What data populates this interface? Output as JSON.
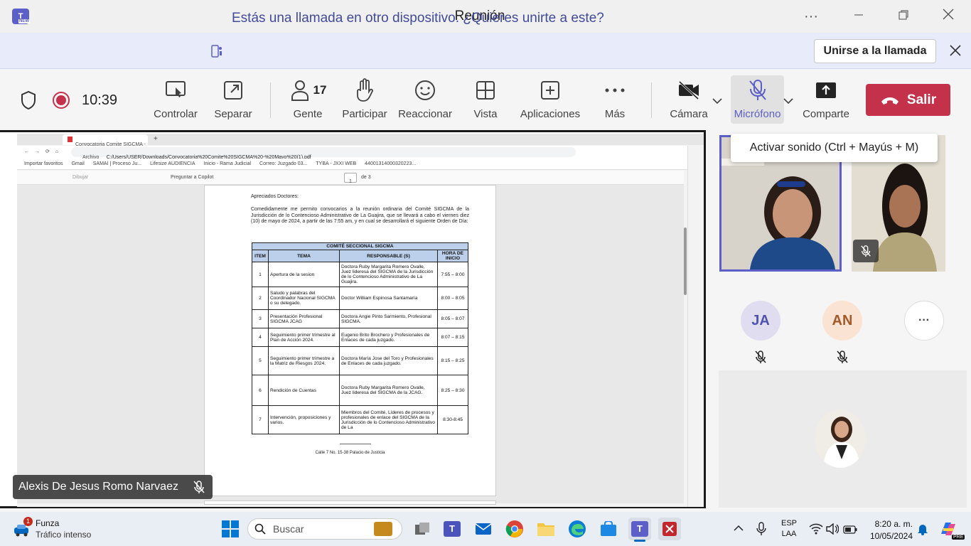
{
  "window": {
    "title": "Reunión",
    "more": "···"
  },
  "banner": {
    "text": "Estás una llamada en otro dispositivo. ¿Quieres unirte a este?",
    "join_label": "Unirse a la llamada"
  },
  "toolbar": {
    "time": "10:39",
    "items": [
      {
        "label": "Controlar"
      },
      {
        "label": "Separar"
      },
      {
        "label": "Gente",
        "count": "17"
      },
      {
        "label": "Participar"
      },
      {
        "label": "Reaccionar"
      },
      {
        "label": "Vista"
      },
      {
        "label": "Aplicaciones"
      },
      {
        "label": "Más"
      },
      {
        "label": "Cámara"
      },
      {
        "label": "Micrófono"
      },
      {
        "label": "Comparte"
      }
    ],
    "leave_label": "Salir"
  },
  "tooltip": "Activar sonido (Ctrl + Mayús + M)",
  "browser": {
    "tab_title": "Convocatoria Comite SIGCMA - I",
    "address_label": "Archivo",
    "address": "C:/Users/USER/Downloads/Convocatoria%20Comite%20SIGCMA%20-%20Mayo%20(1).pdf",
    "bookmarks": [
      "Importar favoritos",
      "Gmail",
      "SAMAI | Proceso Ju...",
      "Lifesize AUDIENCIA",
      "Inicio - Rama Judicial",
      "Correo: Juzgado 03...",
      "TYBA - JXXI WEB",
      "44001314000320223..."
    ],
    "pdf_toolbar": {
      "draw": "Dibujar",
      "ask": "Preguntar a Copilot",
      "page": "1",
      "of": "de 3"
    }
  },
  "document": {
    "greeting": "Apreciados Doctores:",
    "intro": "Comedidamente me permito convocarios a la reunión ordinaria del Comité SIGCMA de la Jurisdicción de lo Contencioso Administrativo de La Guajira, que se llevará a cabo el viernes diez (10) de mayo de 2024, a partir de las 7:55 am, y en cual se desarrollará el siguiente Orden de Día:",
    "table_title": "COMITÉ SECCIONAL SIGCMA",
    "headers": [
      "ITEM",
      "TEMA",
      "RESPONSABLE (S)",
      "HORA DE INICIO"
    ],
    "rows": [
      [
        "1",
        "Apertura de la sesion",
        "Doctora Ruby Margarita Romero Ovalle, Juez lideresa del SIGCMA de la Jurisdicción de lo Contencioso Administrativo de La Guajira.",
        "7:55 – 8:00"
      ],
      [
        "2",
        "Saludo y palabras del Coordinador Nacional SIGCMA o su delegado.",
        "Doctor William Espinosa Santamaría",
        "8:00 – 8:05"
      ],
      [
        "3",
        "Presentación Profesional SIGCMA JCAG",
        "Doctora Angie Pinto Sarmiento, Profesional SIGCMA.",
        "8:05 – 8:07"
      ],
      [
        "4",
        "Seguimiento primer trimestre al Plan de Acción 2024.",
        "Eugenio Brito Brochero y Profesionales de Enlaces de cada juzgado.",
        "8:07 – 8:15"
      ],
      [
        "5",
        "Seguimiento primer trimestre a la Matriz de Riesgos 2024.",
        "Doctora María Jose del Toro y Profesionales de Enlaces de cada juzgado.",
        "8:15 – 8:25"
      ],
      [
        "6",
        "Rendición de Cuentas",
        "Doctora Ruby Margarita Romero Ovalle, Juez lideresa del SIGCMA de la JCAG.",
        "8:25 – 8:30"
      ],
      [
        "7",
        "Intervención, proposiciones y varios.",
        "Miembros del Comité, Líderes de procesos y profesionales de enlace del SIGCMA de la Jurisdicción de lo Contencioso Administrativo de La",
        "8:30-8:45"
      ]
    ],
    "footer": "Calle 7 No. 15-38 Palacio de Justicia"
  },
  "presenter_name": "Alexis De Jesus Romo Narvaez",
  "participants": [
    {
      "initials": "JA"
    },
    {
      "initials": "AN"
    }
  ],
  "more_participants": "···",
  "taskbar": {
    "weather_title": "Funza",
    "weather_sub": "Tráfico intenso",
    "weather_badge": "1",
    "search": "Buscar",
    "lang": "ESP",
    "lang_sub": "LAA",
    "time": "8:20 a. m.",
    "date": "10/05/2024",
    "new_badge": "NEW",
    "pre_badge": "PRE"
  },
  "colors": {
    "accent": "#5b5fc7",
    "leave": "#c4314b",
    "banner": "#e8ebfa",
    "table_header": "#bcd0ec"
  }
}
